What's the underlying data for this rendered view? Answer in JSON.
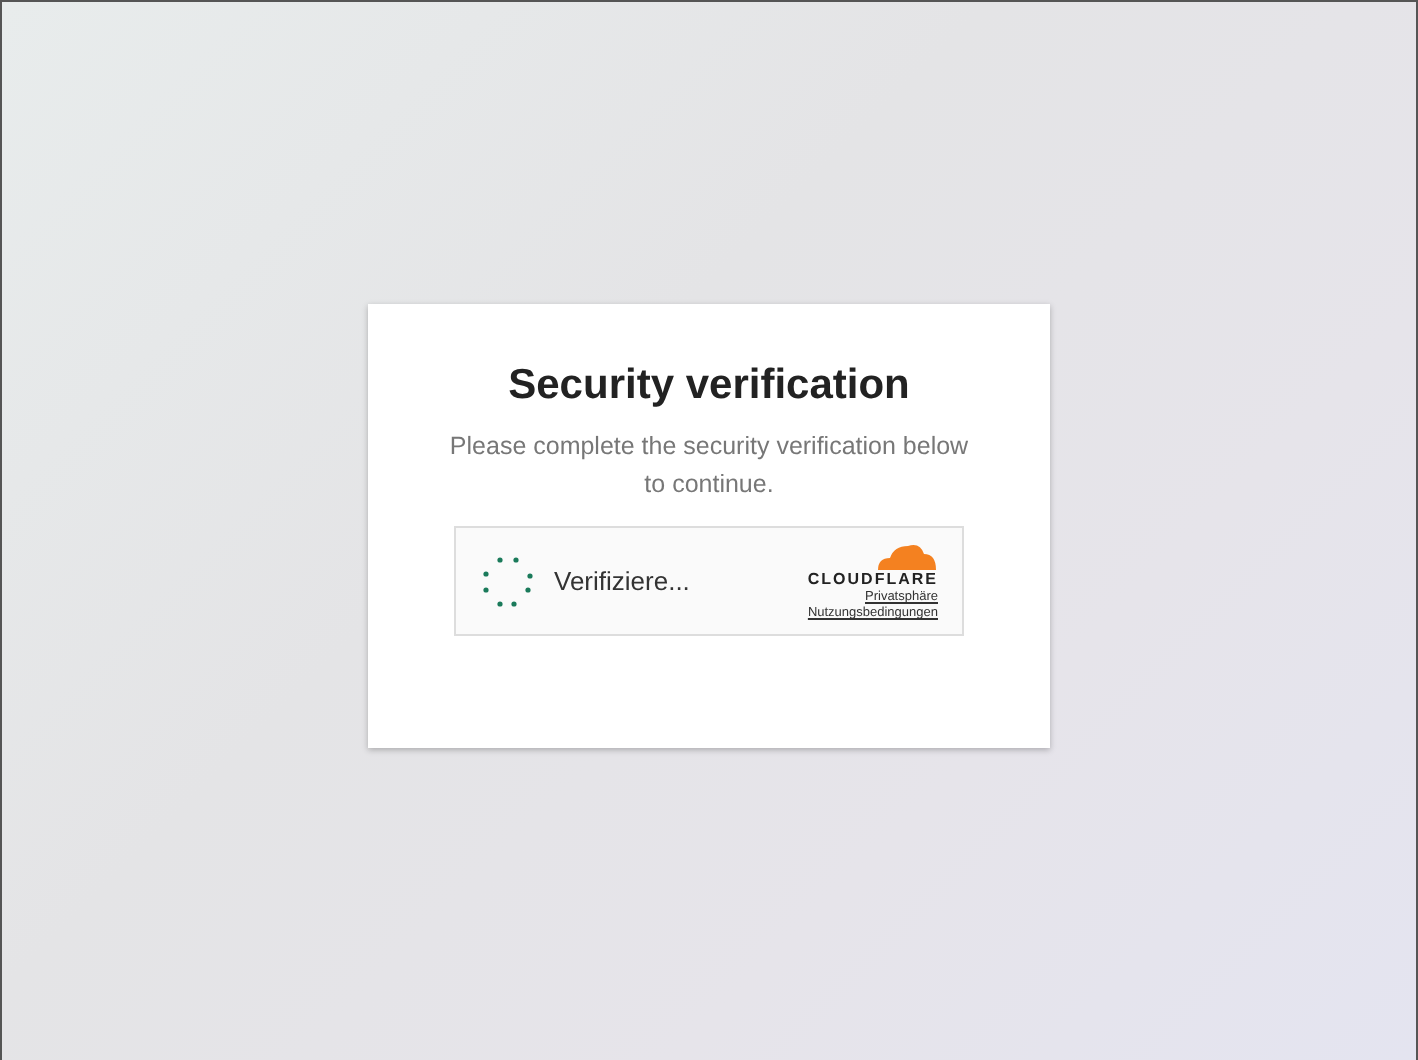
{
  "card": {
    "title": "Security verification",
    "message": "Please complete the security verification below to continue."
  },
  "widget": {
    "status": "Verifiziere...",
    "brand": "CLOUDFLARE",
    "links": [
      "Privatsphäre",
      "Nutzungsbedingungen"
    ]
  }
}
